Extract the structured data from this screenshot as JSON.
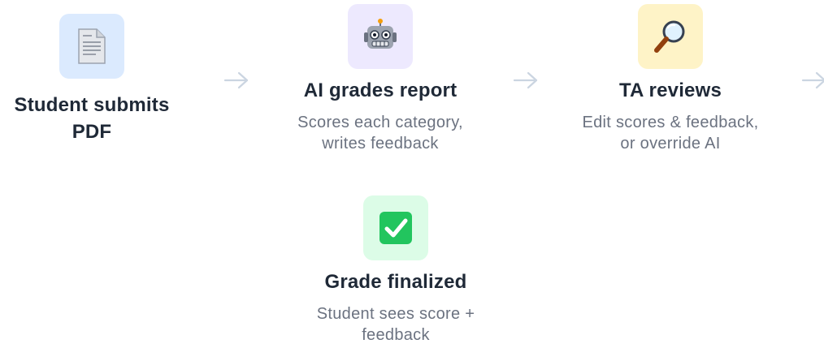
{
  "steps": [
    {
      "icon": "document-icon",
      "glyph": "📄",
      "bg": "#dbeafe",
      "title": "Student submits PDF",
      "description": ""
    },
    {
      "icon": "robot-icon",
      "glyph": "🤖",
      "bg": "#ede9fe",
      "title": "AI grades report",
      "description_line1": "Scores each category,",
      "description_line2": "writes feedback"
    },
    {
      "icon": "magnifying-glass-icon",
      "glyph": "🔍",
      "bg": "#fef3c7",
      "title": "TA reviews",
      "description_line1": "Edit scores & feedback,",
      "description_line2": "or override AI"
    },
    {
      "icon": "check-mark-icon",
      "glyph": "✅",
      "bg": "#dcfce7",
      "title": "Grade finalized",
      "description_line1": "Student sees score +",
      "description_line2": "feedback"
    }
  ],
  "colors": {
    "title": "#1f2937",
    "description": "#6b7280",
    "arrow": "#cbd5e1"
  }
}
